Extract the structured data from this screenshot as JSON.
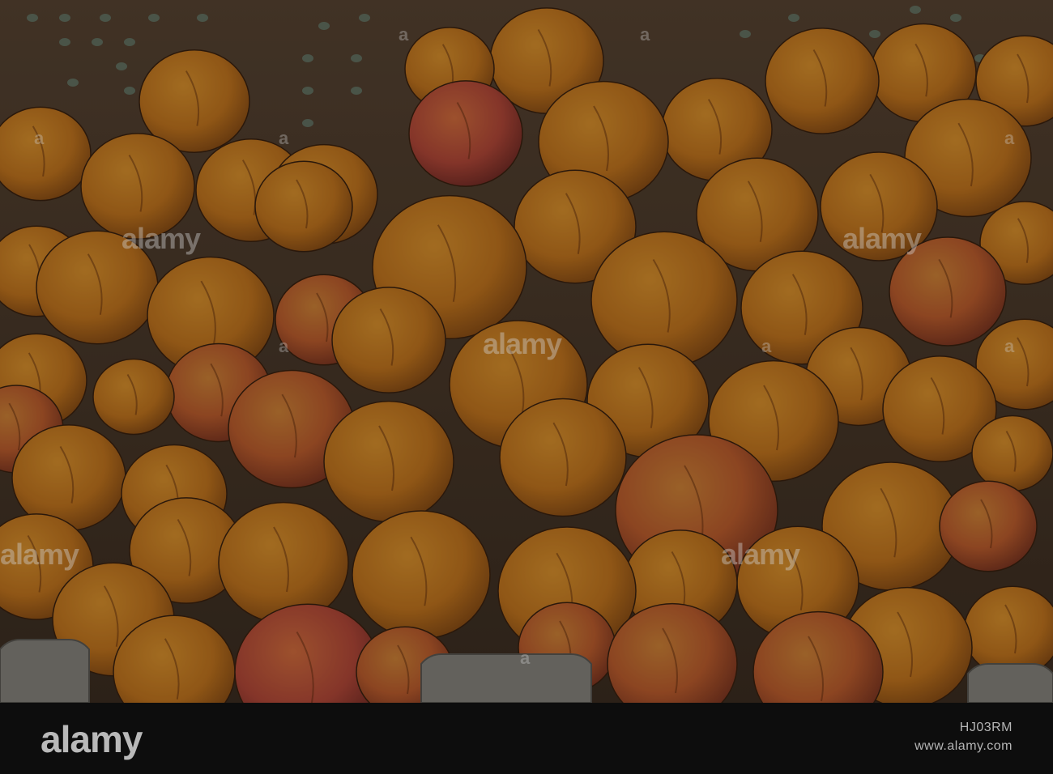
{
  "photo": {
    "subject": "apricots",
    "colors": {
      "crate": "#4a3a2c",
      "crate_hole": "#6e8a7a",
      "apricot_base": "#c8791f",
      "apricot_blush": "#b5503a",
      "overlay": "#000000"
    }
  },
  "watermark": {
    "text": "alamy",
    "mark": "a"
  },
  "footer": {
    "brand": "alamy",
    "image_id": "HJ03RM",
    "site": "www.alamy.com"
  }
}
